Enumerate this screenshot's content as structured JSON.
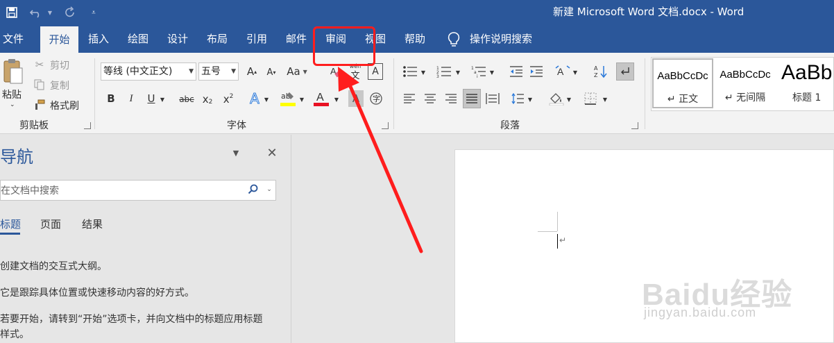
{
  "window": {
    "title": "新建 Microsoft Word 文档.docx  -  Word"
  },
  "tabs": [
    "文件",
    "开始",
    "插入",
    "绘图",
    "设计",
    "布局",
    "引用",
    "邮件",
    "审阅",
    "视图",
    "帮助",
    "操作说明搜索"
  ],
  "clipboard": {
    "paste": "粘贴",
    "cut": "剪切",
    "copy": "复制",
    "format_painter": "格式刷",
    "group": "剪贴板"
  },
  "font": {
    "name": "等线 (中文正文)",
    "size": "五号",
    "group": "字体",
    "change_case": "Aa",
    "phonetic_top": "wén",
    "phonetic_bottom": "文"
  },
  "paragraph": {
    "group": "段落"
  },
  "styles": [
    {
      "sample": "AaBbCcDc",
      "name": "↵ 正文"
    },
    {
      "sample": "AaBbCcDc",
      "name": "↵ 无间隔"
    },
    {
      "sample": "AaBb",
      "name": "标题 1"
    }
  ],
  "nav": {
    "title": "导航",
    "search_placeholder": "在文档中搜索",
    "tabs": [
      "标题",
      "页面",
      "结果"
    ],
    "lines": [
      "创建文档的交互式大纲。",
      "它是跟踪具体位置或快速移动内容的好方式。",
      "若要开始，请转到“开始”选项卡，并向文档中的标题应用标题",
      "样式。"
    ]
  },
  "watermark": {
    "brand": "Baidu经验",
    "url": "jingyan.baidu.com"
  },
  "colors": {
    "accent": "#2b579a",
    "annotation": "#ff1d1d",
    "highlight": "#ffff00",
    "font_color": "#e81123"
  }
}
